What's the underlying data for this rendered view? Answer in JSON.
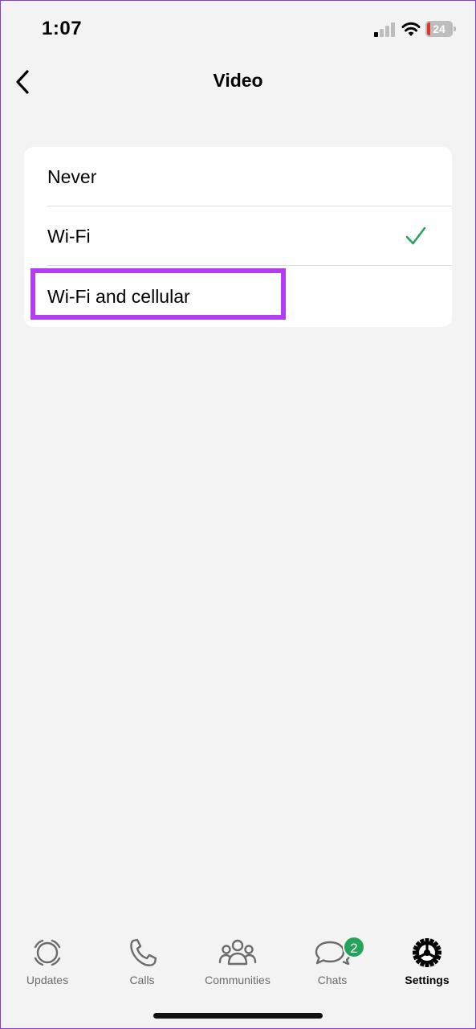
{
  "status_bar": {
    "time": "1:07",
    "battery_level": "24",
    "icons": [
      "cellular-signal-icon",
      "wifi-icon",
      "battery-icon"
    ]
  },
  "nav": {
    "back_icon": "chevron-left-icon",
    "title": "Video"
  },
  "options": [
    {
      "label": "Never",
      "selected": false
    },
    {
      "label": "Wi-Fi",
      "selected": true
    },
    {
      "label": "Wi-Fi and cellular",
      "selected": false
    }
  ],
  "highlight_color": "#b23ef0",
  "accent_color": "#25a35a",
  "tabs": [
    {
      "label": "Updates",
      "icon": "updates-icon",
      "active": false
    },
    {
      "label": "Calls",
      "icon": "phone-icon",
      "active": false
    },
    {
      "label": "Communities",
      "icon": "communities-icon",
      "active": false
    },
    {
      "label": "Chats",
      "icon": "chat-bubbles-icon",
      "active": false,
      "badge": "2"
    },
    {
      "label": "Settings",
      "icon": "gear-icon",
      "active": true
    }
  ]
}
